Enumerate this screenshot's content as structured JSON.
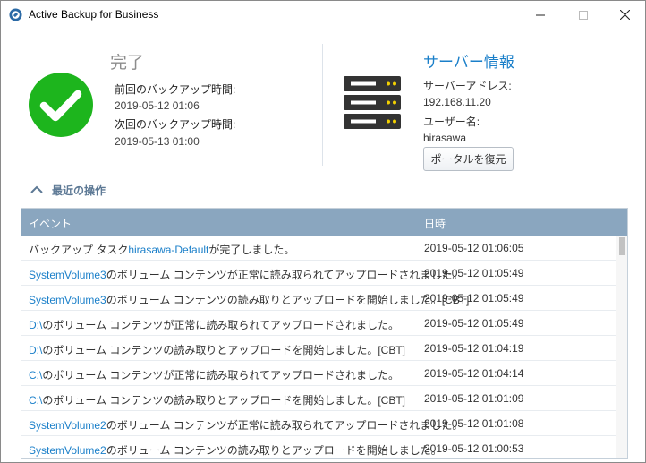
{
  "window": {
    "title": "Active Backup for Business"
  },
  "status": {
    "title": "完了",
    "last_backup_label": "前回のバックアップ時間:",
    "last_backup_value": "2019-05-12 01:06",
    "next_backup_label": "次回のバックアップ時間:",
    "next_backup_value": "2019-05-13 01:00",
    "icon": "check-circle-icon",
    "color": "#1db51d"
  },
  "server": {
    "title": "サーバー情報",
    "address_label": "サーバーアドレス:",
    "address_value": "192.168.11.20",
    "user_label": "ユーザー名:",
    "user_value": "hirasawa",
    "restore_button": "ポータルを復元",
    "icon": "server-icon"
  },
  "recent": {
    "title": "最近の操作",
    "columns": [
      "イベント",
      "日時"
    ],
    "rows": [
      {
        "prefix": "バックアップ タスク",
        "link": "hirasawa-Default",
        "suffix": "が完了しました。",
        "date": "2019-05-12 01:06:05"
      },
      {
        "prefix": "",
        "link": "SystemVolume3",
        "suffix": "のボリューム コンテンツが正常に読み取られてアップロードされました。",
        "date": "2019-05-12 01:05:49"
      },
      {
        "prefix": "",
        "link": "SystemVolume3",
        "suffix": "のボリューム コンテンツの読み取りとアップロードを開始しました。[CBT]",
        "date": "2019-05-12 01:05:49"
      },
      {
        "prefix": "",
        "link": "D:\\",
        "suffix": "のボリューム コンテンツが正常に読み取られてアップロードされました。",
        "date": "2019-05-12 01:05:49"
      },
      {
        "prefix": "",
        "link": "D:\\",
        "suffix": "のボリューム コンテンツの読み取りとアップロードを開始しました。[CBT]",
        "date": "2019-05-12 01:04:19"
      },
      {
        "prefix": "",
        "link": "C:\\",
        "suffix": "のボリューム コンテンツが正常に読み取られてアップロードされました。",
        "date": "2019-05-12 01:04:14"
      },
      {
        "prefix": "",
        "link": "C:\\",
        "suffix": "のボリューム コンテンツの読み取りとアップロードを開始しました。[CBT]",
        "date": "2019-05-12 01:01:09"
      },
      {
        "prefix": "",
        "link": "SystemVolume2",
        "suffix": "のボリューム コンテンツが正常に読み取られてアップロードされました。",
        "date": "2019-05-12 01:01:08"
      },
      {
        "prefix": "",
        "link": "SystemVolume2",
        "suffix": "のボリューム コンテンツの読み取りとアップロードを開始しました。",
        "date": "2019-05-12 01:00:53"
      }
    ]
  },
  "colors": {
    "accent": "#1a7fc9",
    "table_header": "#8aa6bf",
    "success": "#1db51d"
  }
}
